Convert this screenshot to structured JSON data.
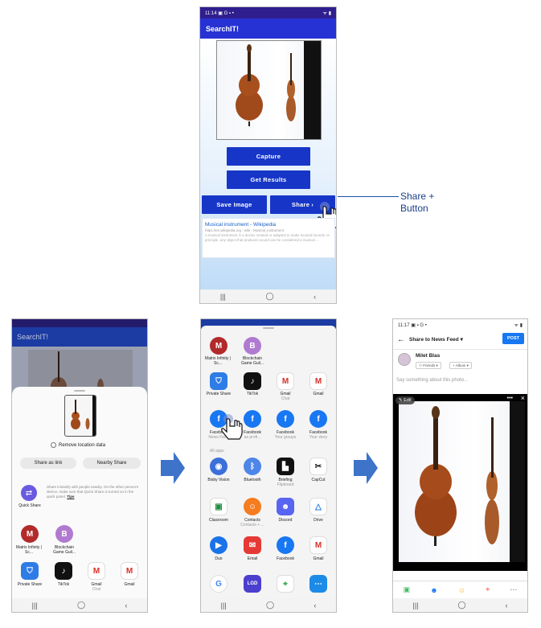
{
  "phone1": {
    "status_time": "11:14",
    "status_icons": "▣ G ▪ •",
    "status_right": "ᯤ ▮",
    "app_title": "SearchIT!",
    "buttons": {
      "capture": "Capture",
      "get_results": "Get Results",
      "save_image": "Save Image",
      "share": "Share"
    },
    "result": {
      "title": "Musical instrument - Wikipedia",
      "url": "https://en.wikipedia.org › wiki › Musical_instrument",
      "snippet": "A musical instrument is a device created or adapted to make musical sounds. In principle, any object that produces sound can be considered a musical ..."
    },
    "callout_lines": [
      "Share +",
      "Button"
    ]
  },
  "phone2": {
    "app_title": "SearchIT!",
    "remove_location": "Remove location data",
    "share_as_link": "Share as link",
    "nearby_share": "Nearby Share",
    "quick_share_label": "Quick Share",
    "quick_share_text": "Share instantly with people nearby. On the other person's device, make sure that Quick Share is turned on in the quick panel.",
    "tips_link": "Tips",
    "people": [
      {
        "name": "Matrix Infinity | Sc..."
      },
      {
        "name": "Blockchain Game Guil..."
      }
    ],
    "apps": [
      {
        "name": "Private Share",
        "sub": ""
      },
      {
        "name": "TikTok",
        "sub": ""
      },
      {
        "name": "Gmail",
        "sub": "Chat"
      },
      {
        "name": "Gmail",
        "sub": ""
      }
    ]
  },
  "phone3": {
    "people": [
      {
        "name": "Matrix Infinity | Sc..."
      },
      {
        "name": "Blockchain Game Guil..."
      }
    ],
    "row1": [
      {
        "name": "Private Share",
        "sub": ""
      },
      {
        "name": "TikTok",
        "sub": ""
      },
      {
        "name": "Gmail",
        "sub": "Chat"
      },
      {
        "name": "Gmail",
        "sub": ""
      }
    ],
    "row2": [
      {
        "name": "Facebook",
        "sub": "News Feed"
      },
      {
        "name": "Facebook",
        "sub": "as profi..."
      },
      {
        "name": "Facebook",
        "sub": "Your groups"
      },
      {
        "name": "Facebook",
        "sub": "Your story"
      }
    ],
    "all_apps_label": "All apps",
    "all_apps": [
      {
        "name": "Bixby Vision",
        "sub": ""
      },
      {
        "name": "Bluetooth",
        "sub": ""
      },
      {
        "name": "Briefing",
        "sub": "Flipboard"
      },
      {
        "name": "CapCut",
        "sub": ""
      },
      {
        "name": "Classroom",
        "sub": ""
      },
      {
        "name": "Contacts",
        "sub": "Contacts + ..."
      },
      {
        "name": "Discord",
        "sub": ""
      },
      {
        "name": "Drive",
        "sub": ""
      },
      {
        "name": "Duo",
        "sub": ""
      },
      {
        "name": "Email",
        "sub": ""
      },
      {
        "name": "Facebook",
        "sub": ""
      },
      {
        "name": "Gmail",
        "sub": ""
      }
    ]
  },
  "phone4": {
    "status_time": "11:17",
    "status_icons": "▣ ▪ G •",
    "header_title": "Share to News Feed ▾",
    "post_button": "POST",
    "user_name": "Milet Blas",
    "audience": "Friends ▾",
    "album": "+ Album ▾",
    "placeholder": "Say something about this photo...",
    "edit_label": "Edit"
  },
  "nav": {
    "recent": "|||",
    "home": "◯",
    "back": "‹"
  },
  "colors": {
    "primary": "#2732d4",
    "button": "#1736c8",
    "status": "#2f1e8e",
    "facebook": "#1877f2",
    "arrow": "#3d73c8"
  }
}
